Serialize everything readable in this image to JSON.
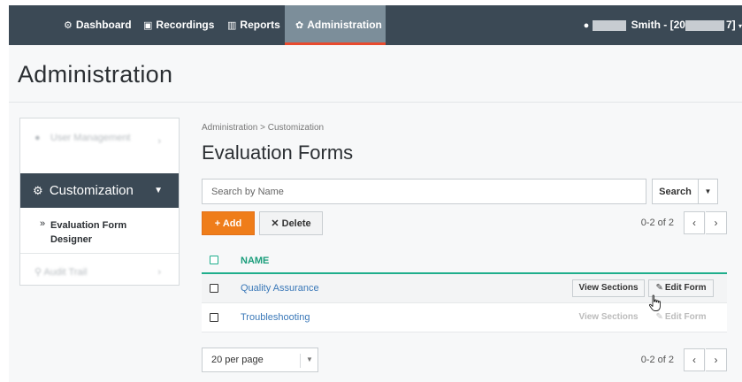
{
  "topnav": {
    "items": [
      {
        "label": "Dashboard",
        "icon": "dashboard-icon"
      },
      {
        "label": "Recordings",
        "icon": "recordings-icon"
      },
      {
        "label": "Reports",
        "icon": "reports-icon"
      },
      {
        "label": "Administration",
        "icon": "gear-icon",
        "active": true
      }
    ],
    "user": {
      "name_prefix": "Smith - [20",
      "name_suffix": "7]"
    }
  },
  "page_title": "Administration",
  "sidebar": {
    "user_management": "User Management",
    "customization": "Customization",
    "evaluation_form_designer": "Evaluation Form Designer",
    "audit_trail": "Audit Trail"
  },
  "breadcrumb": "Administration > Customization",
  "main_title": "Evaluation Forms",
  "search": {
    "placeholder": "Search by Name",
    "button": "Search"
  },
  "actions": {
    "add": "Add",
    "delete": "Delete"
  },
  "pager": {
    "info": "0-2 of 2"
  },
  "table": {
    "column_name": "NAME",
    "rows": [
      {
        "name": "Quality Assurance",
        "view": "View Sections",
        "edit": "Edit Form"
      },
      {
        "name": "Troubleshooting",
        "view": "View Sections",
        "edit": "Edit Form"
      }
    ]
  },
  "per_page": "20 per page",
  "colors": {
    "nav_bg": "#3b4955",
    "accent_orange": "#ef7d1a",
    "accent_teal": "#1fae8c",
    "link_blue": "#3a78b8"
  }
}
